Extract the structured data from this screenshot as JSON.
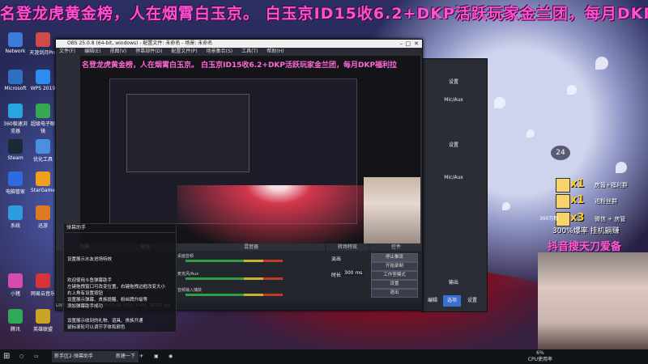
{
  "banner": "名登龙虎黄金榜，人在烟霄白玉京。 白玉京ID15收6.2+DKP活跃玩家金兰团，每月DKP福利拉",
  "desktop_icons": [
    "Network",
    "天涯剑月Pro",
    "Microsoft",
    "WPS 2019",
    "360极速浏览器",
    "超级电子眼镜",
    "Steam",
    "优化工具",
    "电脑管家",
    "StarGame",
    "系统",
    "迅游",
    "小猪",
    "网易云音乐",
    "腾讯",
    "英雄联盟"
  ],
  "obs": {
    "title": "OBS 25.0.8 (64-bit, windows) - 配置文件: 未命名 - 场景: 未命名",
    "menu": [
      "文件(F)",
      "编辑(E)",
      "视图(V)",
      "停靠部件(D)",
      "配置文件(P)",
      "场景集合(S)",
      "工具(T)",
      "帮助(H)"
    ],
    "preview_banner": "名登龙虎黄金榜，人在烟霄白玉京。 白玉京ID15收6.2+DKP活跃玩家金兰团，每月DKP福利拉",
    "dock_headers": [
      "场景",
      "来源",
      "混音器",
      "转场特效",
      "控件"
    ],
    "mixer": [
      "桌面音频",
      "麦克风/Aux",
      "音频输入捕获"
    ],
    "transition": "淡出",
    "duration_label": "时长",
    "duration_value": "300 ms",
    "controls": [
      "停止推流",
      "开始录制",
      "工作室模式",
      "设置",
      "退出"
    ],
    "status": "LIVE: 00:00:00   REC: 00:00:00   CPU: 3.4%, 30.00 fps"
  },
  "win2": {
    "items": [
      "设置",
      "Mic/Aux",
      "设置",
      "Mic/Aux",
      "输出",
      "编辑",
      "选项",
      "设置"
    ]
  },
  "chat": {
    "header": "弹幕助手",
    "lines": [
      "设置展示水友进场特效",
      "欢迎使用斗鱼弹幕助手",
      "左键拖拽窗口可改变位置，右键拖拽边框改变大小",
      "右上角有设置按钮",
      "设置展示弹幕、贵族提醒、粉丝牌升级等",
      "添加弹幕助手成功",
      "设置展示收到的礼物、道具、贵族开通",
      "鼠标滚轮可以调节字体和颜色"
    ]
  },
  "gifts": [
    {
      "mult": "x1",
      "label": "房管+福利群"
    },
    {
      "mult": "x1",
      "label": "进粉丝群"
    },
    {
      "mult": "x3",
      "label": "微信 + 房管"
    }
  ],
  "rate": "300%爆率 挂机躺赚",
  "marquee": "抖音搜天刀爱备",
  "badge": "24",
  "count_label": "360万粉",
  "taskbar": {
    "items": [
      "新手区2-弹幕助手",
      "新建一下"
    ],
    "time": "6%",
    "cpu": "CPU使用率"
  }
}
